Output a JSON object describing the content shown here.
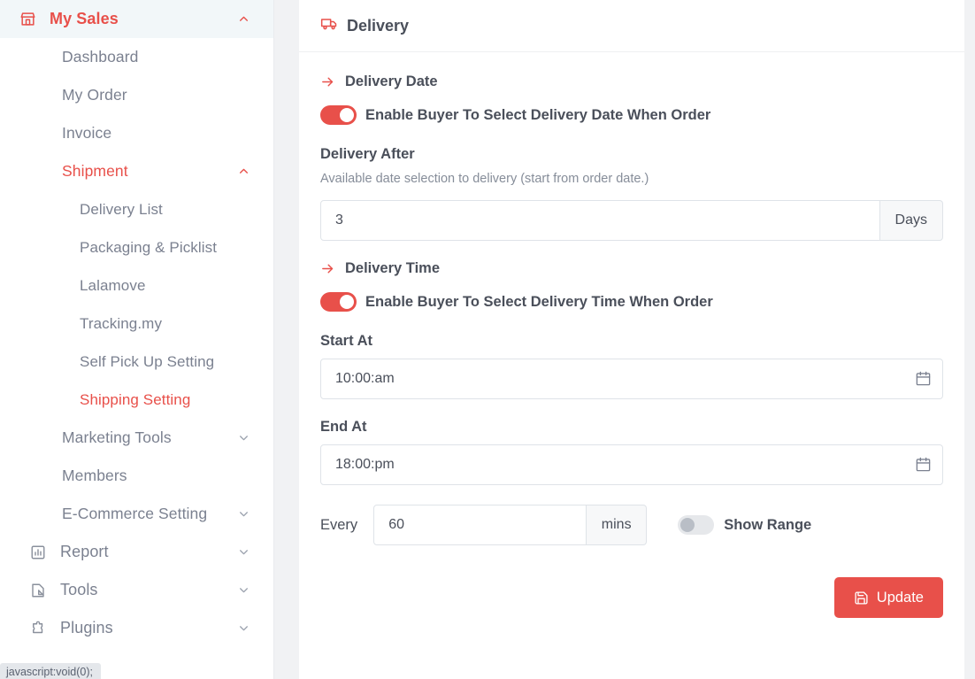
{
  "sidebar": {
    "brand": {
      "label": "My Sales",
      "icon": "shop-icon",
      "chevron": "chevron-up-icon",
      "active": true
    },
    "items": [
      {
        "label": "Dashboard",
        "level": 1,
        "icon": null,
        "chevron": null,
        "active": false
      },
      {
        "label": "My Order",
        "level": 1,
        "icon": null,
        "chevron": null,
        "active": false
      },
      {
        "label": "Invoice",
        "level": 1,
        "icon": null,
        "chevron": null,
        "active": false
      },
      {
        "label": "Shipment",
        "level": 1,
        "icon": null,
        "chevron": "chevron-up-icon",
        "active": true
      },
      {
        "label": "Delivery List",
        "level": 2,
        "icon": null,
        "chevron": null,
        "active": false
      },
      {
        "label": "Packaging & Picklist",
        "level": 2,
        "icon": null,
        "chevron": null,
        "active": false
      },
      {
        "label": "Lalamove",
        "level": 2,
        "icon": null,
        "chevron": null,
        "active": false
      },
      {
        "label": "Tracking.my",
        "level": 2,
        "icon": null,
        "chevron": null,
        "active": false
      },
      {
        "label": "Self Pick Up Setting",
        "level": 2,
        "icon": null,
        "chevron": null,
        "active": false
      },
      {
        "label": "Shipping Setting",
        "level": 2,
        "icon": null,
        "chevron": null,
        "active": true
      },
      {
        "label": "Marketing Tools",
        "level": 1,
        "icon": null,
        "chevron": "chevron-down-icon",
        "active": false
      },
      {
        "label": "Members",
        "level": 1,
        "icon": null,
        "chevron": null,
        "active": false
      },
      {
        "label": "E-Commerce Setting",
        "level": 1,
        "icon": null,
        "chevron": "chevron-down-icon",
        "active": false
      },
      {
        "label": "Report",
        "level": 0,
        "icon": "bar-chart-icon",
        "chevron": "chevron-down-icon",
        "active": false
      },
      {
        "label": "Tools",
        "level": 0,
        "icon": "tools-icon",
        "chevron": "chevron-down-icon",
        "active": false
      },
      {
        "label": "Plugins",
        "level": 0,
        "icon": "puzzle-icon",
        "chevron": "chevron-down-icon",
        "active": false
      }
    ]
  },
  "statusbar": {
    "text": "javascript:void(0);"
  },
  "panel": {
    "header": {
      "title": "Delivery",
      "icon": "truck-icon"
    },
    "delivery_date": {
      "section_title": "Delivery Date",
      "toggle_label": "Enable Buyer To Select Delivery Date When Order",
      "toggle_on": true,
      "delivery_after_label": "Delivery After",
      "hint": "Available date selection to delivery (start from order date.)",
      "days_value": "3",
      "days_unit": "Days"
    },
    "delivery_time": {
      "section_title": "Delivery Time",
      "toggle_label": "Enable Buyer To Select Delivery Time When Order",
      "toggle_on": true,
      "start_label": "Start At",
      "start_value": "10:00:am",
      "end_label": "End At",
      "end_value": "18:00:pm",
      "every_label": "Every",
      "every_value": "60",
      "every_unit": "mins",
      "show_range_label": "Show Range",
      "show_range_on": false
    },
    "update_button": {
      "label": "Update",
      "icon": "save-icon"
    }
  },
  "colors": {
    "brand_red": "#e8504a",
    "text_dark": "#4a4f5a",
    "text_muted": "#7b8190",
    "border": "#dfe3e8"
  }
}
